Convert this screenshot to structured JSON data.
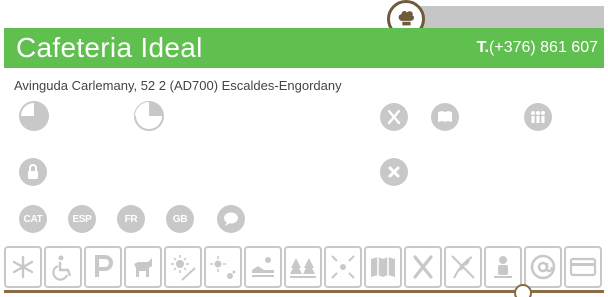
{
  "header": {
    "title": "Cafeteria Ideal",
    "phone_prefix": "T.",
    "phone": "(+376) 861 607"
  },
  "address": "Avinguda Carlemany, 52 2 (AD700) Escaldes-Engordany",
  "languages": [
    "CAT",
    "ESP",
    "FR",
    "GB"
  ],
  "colors": {
    "accent": "#5fbf4f",
    "icon_gray": "#c8c8c8",
    "brown": "#6f5a3b"
  },
  "icons": {
    "row1": [
      "schedule-quarter-icon",
      "schedule-three-quarter-icon",
      "cutlery-icon",
      "menu-icon",
      "group-icon"
    ],
    "row2": [
      "lock-icon",
      "close-icon"
    ],
    "row3": [
      "catalan-icon",
      "spanish-icon",
      "french-icon",
      "english-icon",
      "chat-icon"
    ],
    "amenities": [
      "air-conditioning-icon",
      "wheelchair-icon",
      "parking-icon",
      "pets-icon",
      "terrace-sun-icon",
      "terrace-icon",
      "outdoor-icon",
      "nature-icon",
      "expand-icon",
      "map-icon",
      "restaurant-icon",
      "gluten-free-icon",
      "chef-icon",
      "email-icon",
      "credit-card-icon"
    ]
  }
}
